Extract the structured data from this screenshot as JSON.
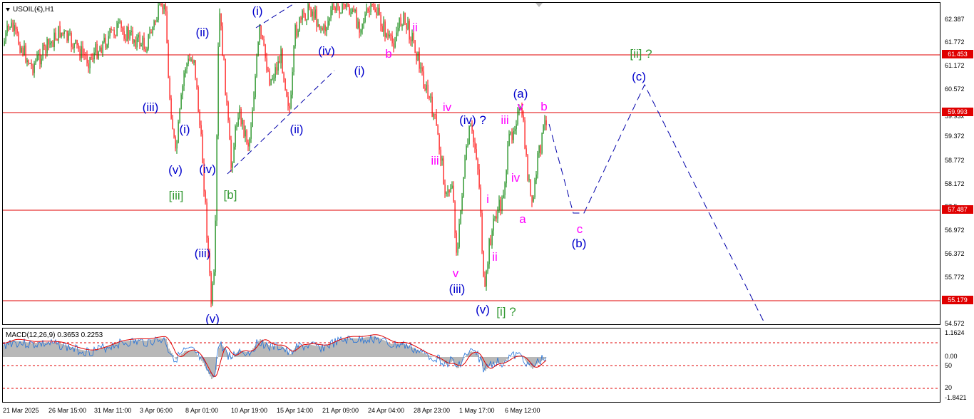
{
  "chart": {
    "symbol_label": "USOIL(€),H1",
    "price_ticks": [
      "62.387",
      "61.772",
      "61.172",
      "60.572",
      "59.372",
      "58.772",
      "58.172",
      "57.572",
      "56.972",
      "56.372",
      "55.772",
      "54.572"
    ],
    "price_ticks_partial": [
      "59.93x",
      "57.5xx"
    ],
    "levels": [
      {
        "value": "61.453",
        "color": "#e00000"
      },
      {
        "value": "59.993",
        "color": "#e00000"
      },
      {
        "value": "57.487",
        "color": "#e00000"
      },
      {
        "value": "55.179",
        "color": "#e00000"
      }
    ],
    "time_labels": [
      "21 Mar 2025",
      "26 Mar 15:00",
      "31 Mar 11:00",
      "3 Apr 06:00",
      "8 Apr 01:00",
      "10 Apr 19:00",
      "15 Apr 14:00",
      "21 Apr 09:00",
      "24 Apr 04:00",
      "28 Apr 23:00",
      "1 May 17:00",
      "6 May 12:00"
    ],
    "wave_labels": [
      {
        "id": "w1",
        "text": "(i)",
        "color": "blue"
      },
      {
        "id": "w2",
        "text": "(ii)",
        "color": "blue"
      },
      {
        "id": "w3",
        "text": "(iii)",
        "color": "blue"
      },
      {
        "id": "w4",
        "text": "(i)",
        "color": "blue"
      },
      {
        "id": "w5",
        "text": "(v)",
        "color": "blue"
      },
      {
        "id": "w6",
        "text": "(iv)",
        "color": "blue"
      },
      {
        "id": "w7",
        "text": "[iii]",
        "color": "green"
      },
      {
        "id": "w8",
        "text": "[b]",
        "color": "green"
      },
      {
        "id": "w9",
        "text": "(iii)",
        "color": "blue"
      },
      {
        "id": "w10",
        "text": "(v)",
        "color": "blue"
      },
      {
        "id": "w11",
        "text": "(ii)",
        "color": "blue"
      },
      {
        "id": "w12",
        "text": "(iv)",
        "color": "blue"
      },
      {
        "id": "w13",
        "text": "(i)",
        "color": "blue"
      },
      {
        "id": "w14",
        "text": "b",
        "color": "mag"
      },
      {
        "id": "w15",
        "text": "ii",
        "color": "mag"
      },
      {
        "id": "w16",
        "text": "iv",
        "color": "mag"
      },
      {
        "id": "w17",
        "text": "iii",
        "color": "mag"
      },
      {
        "id": "w18",
        "text": "v",
        "color": "mag"
      },
      {
        "id": "w19",
        "text": "(iii)",
        "color": "blue"
      },
      {
        "id": "w20",
        "text": "(iv) ?",
        "color": "blue"
      },
      {
        "id": "w21",
        "text": "(v)",
        "color": "blue"
      },
      {
        "id": "w22",
        "text": "[i] ?",
        "color": "green"
      },
      {
        "id": "w23",
        "text": "i",
        "color": "mag"
      },
      {
        "id": "w24",
        "text": "ii",
        "color": "mag"
      },
      {
        "id": "w25",
        "text": "iii",
        "color": "mag"
      },
      {
        "id": "w26",
        "text": "iv",
        "color": "mag"
      },
      {
        "id": "w27",
        "text": "v",
        "color": "mag"
      },
      {
        "id": "w28",
        "text": "(a)",
        "color": "blue"
      },
      {
        "id": "w29",
        "text": "a",
        "color": "mag"
      },
      {
        "id": "w30",
        "text": "b",
        "color": "mag"
      },
      {
        "id": "w31",
        "text": "c",
        "color": "mag"
      },
      {
        "id": "w32",
        "text": "(b)",
        "color": "blue"
      },
      {
        "id": "w33",
        "text": "(c)",
        "color": "blue"
      },
      {
        "id": "w34",
        "text": "[ii] ?",
        "color": "green"
      }
    ]
  },
  "macd": {
    "label": "MACD(12,26,9) 0.3653 0.2253",
    "ticks": [
      "1.1624",
      "0.00",
      "50",
      "20",
      "-1.8421"
    ]
  },
  "colors": {
    "bull": "#008000",
    "bear": "#ff0000",
    "level": "#e00000",
    "projection": "#0000aa",
    "macd_hist": "#b8b8b8",
    "macd_signal": "#e00000",
    "macd_main": "#1e6fd9"
  }
}
